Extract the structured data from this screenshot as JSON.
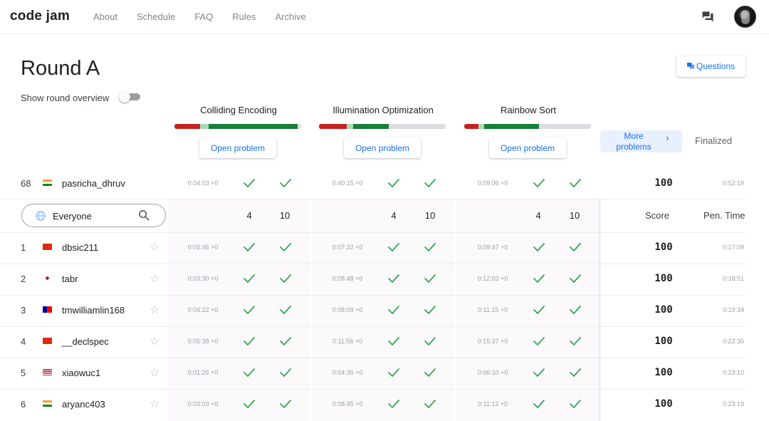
{
  "app": {
    "brand": "code jam"
  },
  "nav": [
    "About",
    "Schedule",
    "FAQ",
    "Rules",
    "Archive"
  ],
  "header": {
    "title": "Round A",
    "questions_label": "Questions",
    "overview_label": "Show round overview",
    "overview_on": false
  },
  "problems": [
    {
      "name": "Colliding Encoding",
      "open_label": "Open problem",
      "bar": {
        "red": 0.2,
        "lightgreen": 0.07,
        "green": 0.7
      }
    },
    {
      "name": "Illumination Optimization",
      "open_label": "Open problem",
      "bar": {
        "red": 0.22,
        "lightgreen": 0.05,
        "green": 0.28
      }
    },
    {
      "name": "Rainbow Sort",
      "open_label": "Open problem",
      "bar": {
        "red": 0.11,
        "lightgreen": 0.05,
        "green": 0.43
      }
    }
  ],
  "more_problems_label": "More problems",
  "status": "Finalized",
  "colors": {
    "red": "#c5221f",
    "lightgreen": "#a8dab5",
    "green": "#188038",
    "check": "#34a853",
    "accent": "#1a73e8"
  },
  "current_user": {
    "rank": "68",
    "name": "pasricha_dhruv",
    "country": "India",
    "times": [
      "0:04:03 +0",
      "0:40:15 +0",
      "0:09:06 +0"
    ],
    "score": "100",
    "penalty": "0:52:19"
  },
  "filter": {
    "value": "Everyone",
    "counts": [
      [
        "4",
        "10"
      ],
      [
        "4",
        "10"
      ],
      [
        "4",
        "10"
      ]
    ],
    "score_header": "Score",
    "penalty_header": "Pen. Time"
  },
  "rows": [
    {
      "rank": "1",
      "name": "dbsic211",
      "country": "Hong Kong",
      "times": [
        "0:02:46 +0",
        "0:07:22 +0",
        "0:09:47 +0"
      ],
      "score": "100",
      "penalty": "0:17:09"
    },
    {
      "rank": "2",
      "name": "tabr",
      "country": "Japan",
      "times": [
        "0:03:30 +0",
        "0:08:48 +0",
        "0:12:03 +0"
      ],
      "score": "100",
      "penalty": "0:18:51"
    },
    {
      "rank": "3",
      "name": "tmwilliamlin168",
      "country": "Taiwan",
      "times": [
        "0:04:22 +0",
        "0:08:09 +0",
        "0:11:15 +0"
      ],
      "score": "100",
      "penalty": "0:19:34"
    },
    {
      "rank": "4",
      "name": "__declspec",
      "country": "Hong Kong",
      "times": [
        "0:05:38 +0",
        "0:11:56 +0",
        "0:15:37 +0"
      ],
      "score": "100",
      "penalty": "0:22:35"
    },
    {
      "rank": "5",
      "name": "xiaowuc1",
      "country": "United States",
      "times": [
        "0:01:26 +0",
        "0:04:36 +0",
        "0:06:10 +0"
      ],
      "score": "100",
      "penalty": "0:23:10"
    },
    {
      "rank": "6",
      "name": "aryanc403",
      "country": "India",
      "times": [
        "0:03:03 +0",
        "0:08:45 +0",
        "0:11:12 +0"
      ],
      "score": "100",
      "penalty": "0:23:19"
    }
  ]
}
